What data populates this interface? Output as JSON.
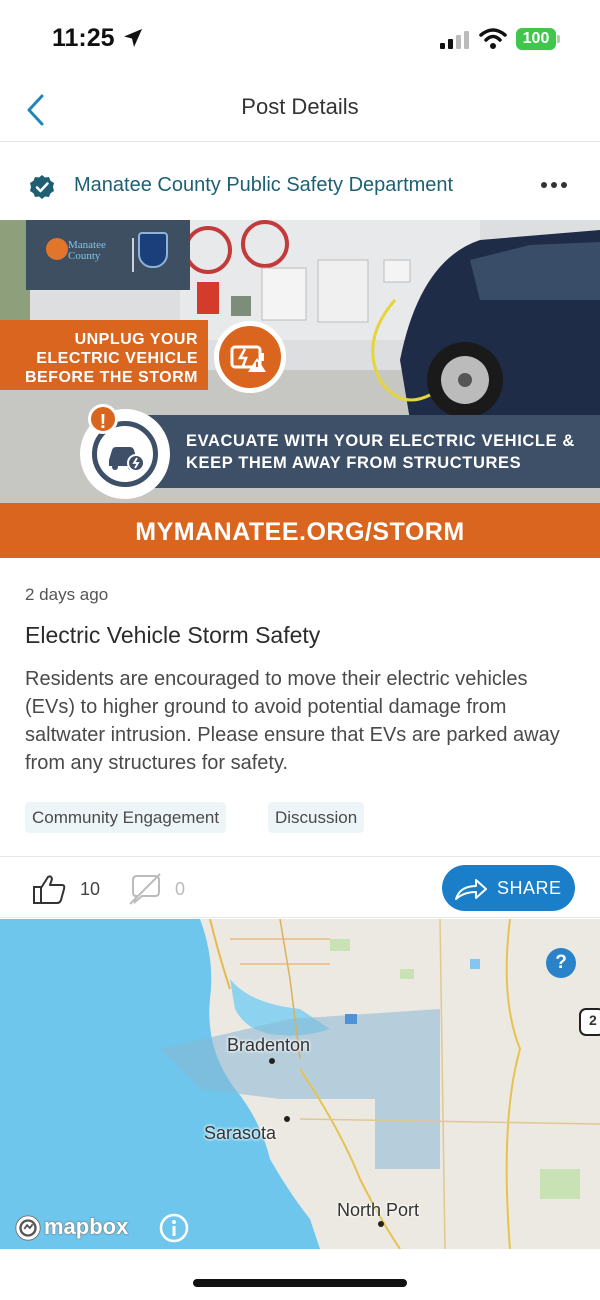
{
  "status_bar": {
    "time": "11:25",
    "battery": "100"
  },
  "nav": {
    "title": "Post Details",
    "back_icon": "chevron-left-icon"
  },
  "post": {
    "author": "Manatee County Public Safety Department",
    "time": "2 days ago",
    "title": "Electric Vehicle Storm Safety",
    "body": "Residents are encouraged to move their electric vehicles (EVs) to higher ground to avoid potential damage from saltwater intrusion. Please ensure that EVs are parked away from any structures for safety.",
    "tags": [
      "Community Engagement",
      "Discussion"
    ],
    "likes": "10",
    "comments": "0",
    "share_label": "SHARE"
  },
  "banner": {
    "logo_text_line1": "Manatee",
    "logo_text_line2": "County",
    "unplug_text": "UNPLUG YOUR ELECTRIC VEHICLE BEFORE THE STORM",
    "evacuate_text": "EVACUATE WITH YOUR ELECTRIC VEHICLE & KEEP THEM AWAY FROM STRUCTURES",
    "url": "MYMANATEE.ORG/STORM"
  },
  "map": {
    "labels": [
      "Bradenton",
      "Sarasota",
      "North Port"
    ],
    "attribution": "mapbox",
    "help": "?",
    "highway_shield": "2"
  },
  "colors": {
    "accent_blue": "#1a7fc8",
    "author_teal": "#1e5f74",
    "banner_orange": "#d9651f",
    "banner_navy": "#3e5067",
    "water": "#6ec6ec"
  }
}
